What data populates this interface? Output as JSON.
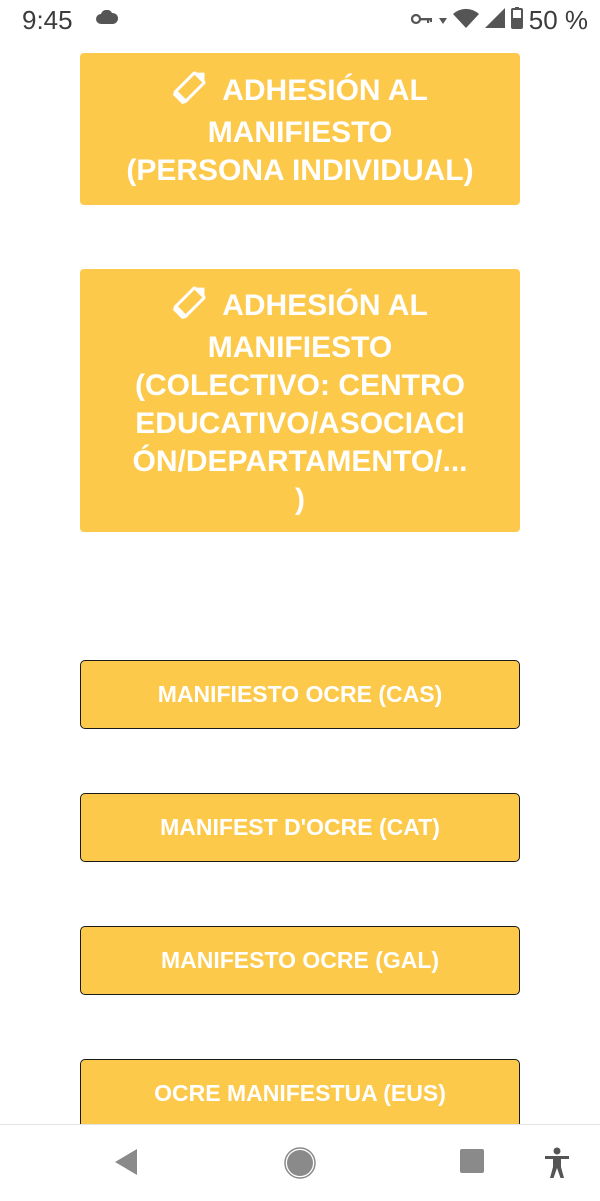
{
  "status_bar": {
    "time": "9:45",
    "battery_percent": "50 %",
    "icons": [
      "cloud-icon",
      "vpn-key-icon",
      "wifi-icon",
      "signal-icon",
      "battery-icon"
    ]
  },
  "buttons": {
    "individual": {
      "line1": "ADHESIÓN AL",
      "line2": "MANIFIESTO",
      "line3": "(PERSONA INDIVIDUAL)",
      "icon": "pencil-icon"
    },
    "colectivo": {
      "line1": "ADHESIÓN AL",
      "line2": "MANIFIESTO",
      "line3": "(COLECTIVO: CENTRO",
      "line4": "EDUCATIVO/ASOCIACI",
      "line5": "ÓN/DEPARTAMENTO/...",
      "line6": ")",
      "icon": "pencil-icon"
    },
    "cas": "MANIFIESTO OCRE (CAS)",
    "cat": "MANIFEST D'OCRE (CAT)",
    "gal": "MANIFESTO OCRE (GAL)",
    "eus": "OCRE MANIFESTUA (EUS)"
  },
  "nav_bar": {
    "icons": [
      "back-icon",
      "home-icon",
      "recents-icon",
      "accessibility-icon"
    ]
  },
  "colors": {
    "button_fill": "#fdc94b",
    "button_text": "#ffffff",
    "button_border": "#1a1a1a",
    "nav_icon": "#8a8a8a"
  }
}
